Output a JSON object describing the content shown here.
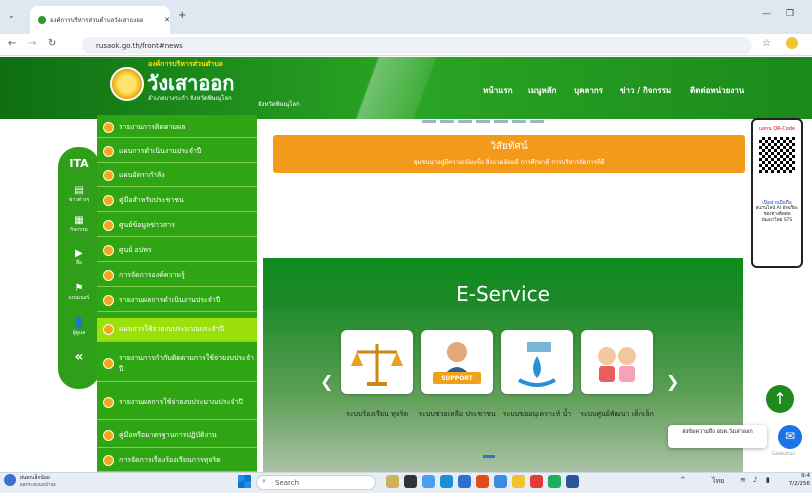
{
  "browser": {
    "tab_title": "องค์การบริหารส่วนตำบลวังเสาธงออ",
    "url": "rusaok.go.th/front#news"
  },
  "site": {
    "org_label": "องค์การบริหารส่วนตำบล",
    "org_name": "วังเสาออก",
    "tagline": "อำเภอบางระกำ จังหวัดพิษณุโลก",
    "province": "จังหวัดพิษณุโลก"
  },
  "nav": [
    "หน้าแรก",
    "เมนูหลัก",
    "บุคลากร",
    "ข่าว / กิจกรรม",
    "ติดต่อหน่วยงาน"
  ],
  "iconbar": [
    {
      "icon": "ITA",
      "label": ""
    },
    {
      "icon": "▤",
      "label": "ข่าวต่างๆ"
    },
    {
      "icon": "▦",
      "label": "กิจกรรม"
    },
    {
      "icon": "▶",
      "label": "สื่อ"
    },
    {
      "icon": "⚑",
      "label": "แบนเนอร์"
    },
    {
      "icon": "👤",
      "label": "ผู้ดูแล"
    },
    {
      "icon": "«",
      "label": ""
    }
  ],
  "menu": [
    "รายงานการติดตามผล",
    "แผนการดำเนินงานประจำปี",
    "แผนอัตรากำลัง",
    "คู่มือสำหรับประชาชน",
    "ศูนย์ข้อมูลข่าวสาร",
    "ศูนย์ อปพร",
    "การจัดการองค์ความรู้",
    "รายงานผลการดำเนินงานประจำปี",
    "แผนการใช้จ่ายงบประมาณประจำปี",
    "รายงานการกำกับติดตามการใช้จ่ายงบประจำปี",
    "รายงานผลการใช้จ่ายงบประมาณประจำปี",
    "คู่มือหรือมาตรฐานการปฏิบัติงาน",
    "การจัดการเรื่องร้องเรียนการทุจริต"
  ],
  "vision": {
    "title": "วิสัยทัศน์",
    "text": "ชุมชนน่าอยู่มีความเข้มแข็ง สิ่งแวดล้อมดี การศึกษาดี การบริหารจัดการที่ดี"
  },
  "eservice": {
    "title": "E-Service",
    "cards": [
      {
        "label": "ระบบร้องเรียน ทุจริต",
        "icon": "scales-icon"
      },
      {
        "label": "ระบบช่วยเหลือ ประชาชน",
        "icon": "support-icon",
        "badge": "SUPPORT"
      },
      {
        "label": "ระบบขออนุเคราะห์ น้ำ",
        "icon": "water-icon"
      },
      {
        "label": "ระบบศูนย์พัฒนา เด็กเล็ก",
        "icon": "children-icon"
      }
    ]
  },
  "qr": {
    "head": "แสกน QR-Code",
    "line1": "เปิดผ่านมือถือ",
    "line2": "สแกนไลน์ AI อัจฉริยะ",
    "line3": "ช่องทางติดต่อ",
    "line4": "พัฒนาโดย STS"
  },
  "chat": {
    "text": "ส่งข้อความถึง อบต.วังเสาออก",
    "brand": "GetButton"
  },
  "taskbar": {
    "weather": "ฝนตกเล็กน้อย",
    "weather_sub": "ผลกระทบนหน้าจอ",
    "search": "Search",
    "lang": "ไทย",
    "time": "9:4",
    "date": "7/2/256"
  },
  "colors": {
    "green": "#2fa514",
    "orange": "#f49a1a",
    "blue": "#1a73e8"
  }
}
